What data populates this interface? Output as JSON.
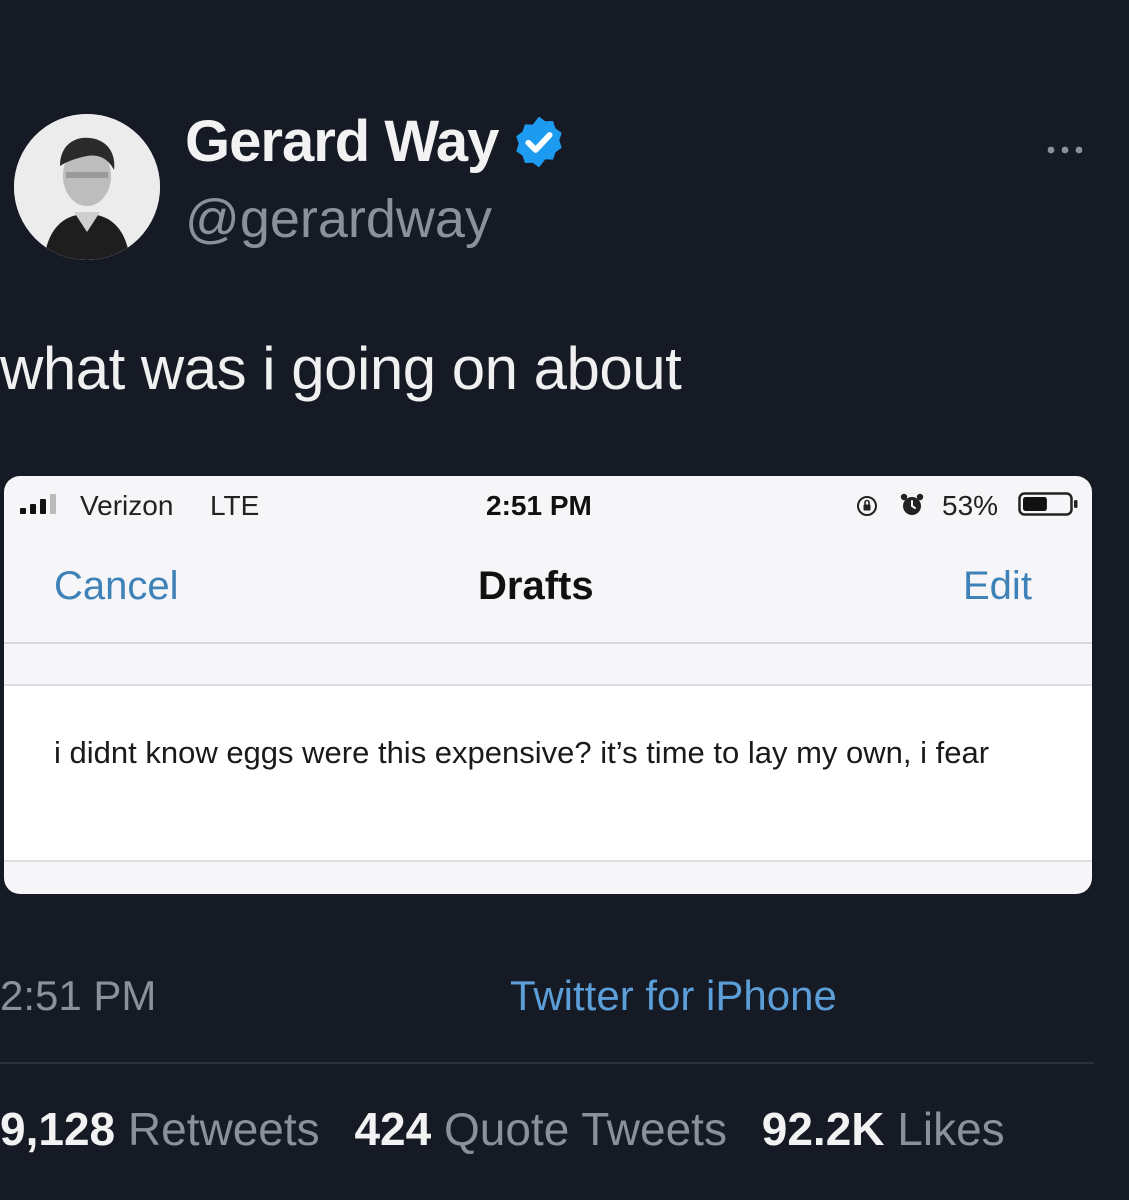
{
  "author": {
    "display_name": "Gerard Way",
    "handle": "@gerardway",
    "verified": true,
    "verified_color": "#1d9bf0"
  },
  "tweet": {
    "text": "what was i going on about",
    "time": "2:51 PM",
    "source": "Twitter for iPhone"
  },
  "stats": {
    "retweets": {
      "count": "9,128",
      "label": "Retweets"
    },
    "quotes": {
      "count": "424",
      "label": "Quote Tweets"
    },
    "likes": {
      "count": "92.2K",
      "label": "Likes"
    }
  },
  "embedded": {
    "status_bar": {
      "carrier": "Verizon",
      "network": "LTE",
      "time": "2:51 PM",
      "battery": "53%",
      "battery_level": 0.53
    },
    "nav": {
      "cancel_label": "Cancel",
      "title": "Drafts",
      "edit_label": "Edit"
    },
    "drafts": [
      {
        "text": "i didnt know eggs were this expensive? it’s time to lay my own, i fear"
      }
    ]
  },
  "icons": {
    "avatar": "profile-photo",
    "verified": "verified-badge-icon",
    "more": "more-icon",
    "signal": "signal-icon",
    "lock": "orientation-lock-icon",
    "alarm": "alarm-icon",
    "battery": "battery-icon"
  },
  "colors": {
    "background": "#161a25",
    "link": "#5c9ed8",
    "ios_link": "#3f82b8"
  }
}
